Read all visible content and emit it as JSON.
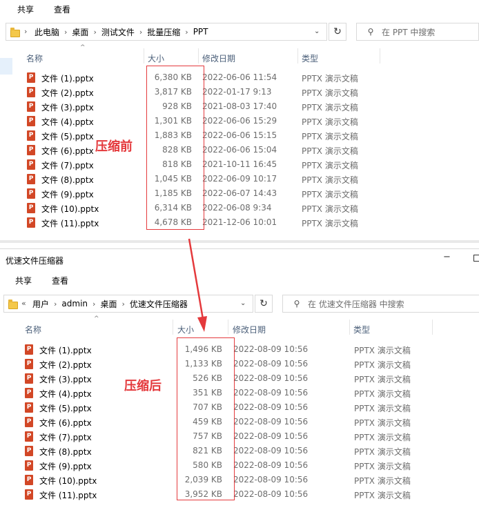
{
  "colors": {
    "accent_red": "#e4393c",
    "pptx_icon": "#d24726",
    "folder": "#f4c84a"
  },
  "before": {
    "menu": {
      "share": "共享",
      "view": "查看"
    },
    "breadcrumb": [
      "此电脑",
      "桌面",
      "测试文件",
      "批量压缩",
      "PPT"
    ],
    "search_placeholder": "在 PPT 中搜索",
    "columns": {
      "name": "名称",
      "size": "大小",
      "date": "修改日期",
      "type": "类型"
    },
    "annotation": "压缩前",
    "files": [
      {
        "name": "文件 (1).pptx",
        "size": "6,380 KB",
        "date": "2022-06-06 11:54",
        "type": "PPTX 演示文稿"
      },
      {
        "name": "文件 (2).pptx",
        "size": "3,817 KB",
        "date": "2022-01-17 9:13",
        "type": "PPTX 演示文稿"
      },
      {
        "name": "文件 (3).pptx",
        "size": "928 KB",
        "date": "2021-08-03 17:40",
        "type": "PPTX 演示文稿"
      },
      {
        "name": "文件 (4).pptx",
        "size": "1,301 KB",
        "date": "2022-06-06 15:29",
        "type": "PPTX 演示文稿"
      },
      {
        "name": "文件 (5).pptx",
        "size": "1,883 KB",
        "date": "2022-06-06 15:15",
        "type": "PPTX 演示文稿"
      },
      {
        "name": "文件 (6).pptx",
        "size": "828 KB",
        "date": "2022-06-06 15:04",
        "type": "PPTX 演示文稿"
      },
      {
        "name": "文件 (7).pptx",
        "size": "818 KB",
        "date": "2021-10-11 16:45",
        "type": "PPTX 演示文稿"
      },
      {
        "name": "文件 (8).pptx",
        "size": "1,045 KB",
        "date": "2022-06-09 10:17",
        "type": "PPTX 演示文稿"
      },
      {
        "name": "文件 (9).pptx",
        "size": "1,185 KB",
        "date": "2022-06-07 14:43",
        "type": "PPTX 演示文稿"
      },
      {
        "name": "文件 (10).pptx",
        "size": "6,314 KB",
        "date": "2022-06-08 9:34",
        "type": "PPTX 演示文稿"
      },
      {
        "name": "文件 (11).pptx",
        "size": "4,678 KB",
        "date": "2021-12-06 10:01",
        "type": "PPTX 演示文稿"
      }
    ]
  },
  "after": {
    "window_title": "优速文件压缩器",
    "title_controls": {
      "minimize": "−"
    },
    "menu": {
      "share": "共享",
      "view": "查看"
    },
    "breadcrumb_prefix": "«",
    "breadcrumb": [
      "用户",
      "admin",
      "桌面",
      "优速文件压缩器"
    ],
    "search_placeholder": "在 优速文件压缩器 中搜索",
    "columns": {
      "name": "名称",
      "size": "大小",
      "date": "修改日期",
      "type": "类型"
    },
    "annotation": "压缩后",
    "files": [
      {
        "name": "文件 (1).pptx",
        "size": "1,496 KB",
        "date": "2022-08-09 10:56",
        "type": "PPTX 演示文稿"
      },
      {
        "name": "文件 (2).pptx",
        "size": "1,133 KB",
        "date": "2022-08-09 10:56",
        "type": "PPTX 演示文稿"
      },
      {
        "name": "文件 (3).pptx",
        "size": "526 KB",
        "date": "2022-08-09 10:56",
        "type": "PPTX 演示文稿"
      },
      {
        "name": "文件 (4).pptx",
        "size": "351 KB",
        "date": "2022-08-09 10:56",
        "type": "PPTX 演示文稿"
      },
      {
        "name": "文件 (5).pptx",
        "size": "707 KB",
        "date": "2022-08-09 10:56",
        "type": "PPTX 演示文稿"
      },
      {
        "name": "文件 (6).pptx",
        "size": "459 KB",
        "date": "2022-08-09 10:56",
        "type": "PPTX 演示文稿"
      },
      {
        "name": "文件 (7).pptx",
        "size": "757 KB",
        "date": "2022-08-09 10:56",
        "type": "PPTX 演示文稿"
      },
      {
        "name": "文件 (8).pptx",
        "size": "821 KB",
        "date": "2022-08-09 10:56",
        "type": "PPTX 演示文稿"
      },
      {
        "name": "文件 (9).pptx",
        "size": "580 KB",
        "date": "2022-08-09 10:56",
        "type": "PPTX 演示文稿"
      },
      {
        "name": "文件 (10).pptx",
        "size": "2,039 KB",
        "date": "2022-08-09 10:56",
        "type": "PPTX 演示文稿"
      },
      {
        "name": "文件 (11).pptx",
        "size": "3,952 KB",
        "date": "2022-08-09 10:56",
        "type": "PPTX 演示文稿"
      }
    ]
  }
}
